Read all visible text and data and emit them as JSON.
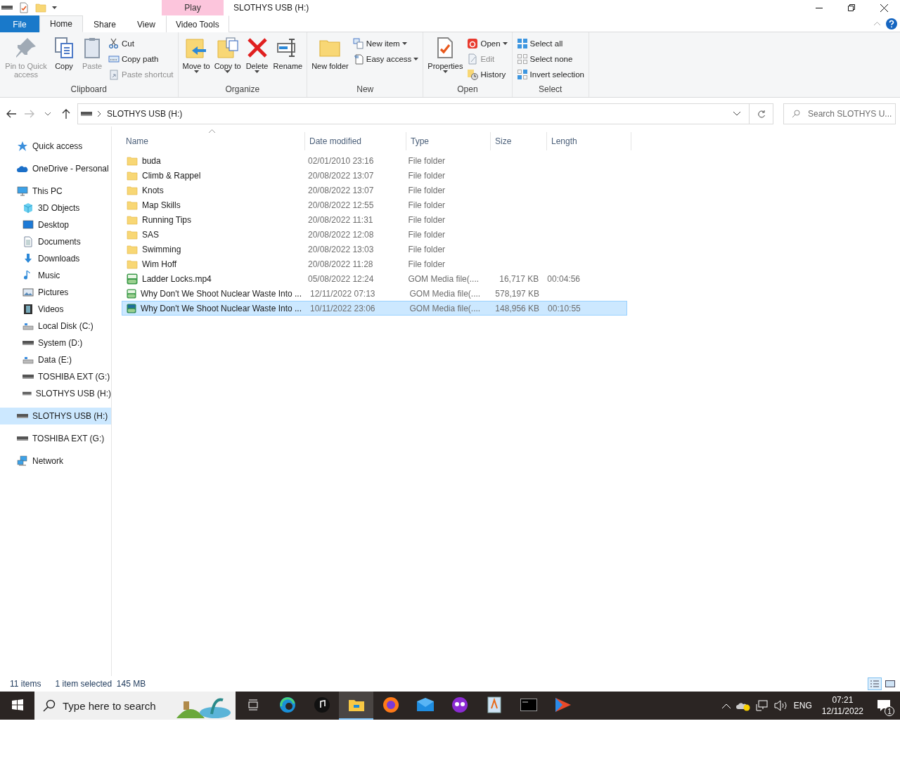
{
  "title_bar": {
    "context_tab": "Play",
    "title": "SLOTHYS USB (H:)"
  },
  "ribbon_tabs": [
    {
      "label": "File",
      "kind": "file",
      "selected": false
    },
    {
      "label": "Home",
      "kind": "normal",
      "selected": true
    },
    {
      "label": "Share",
      "kind": "normal",
      "selected": false
    },
    {
      "label": "View",
      "kind": "normal",
      "selected": false
    },
    {
      "label": "Video Tools",
      "kind": "context",
      "selected": false
    }
  ],
  "ribbon_groups": [
    {
      "label": "Clipboard",
      "items": [
        {
          "label": "Pin to Quick access",
          "kind": "large",
          "disabled": true,
          "dropdown": false
        },
        {
          "label": "Copy",
          "kind": "large",
          "disabled": false,
          "dropdown": false
        },
        {
          "label": "Paste",
          "kind": "large",
          "disabled": true,
          "dropdown": false
        },
        {
          "kind": "stack",
          "items": [
            {
              "label": "Cut",
              "disabled": false,
              "dropdown": false
            },
            {
              "label": "Copy path",
              "disabled": false,
              "dropdown": false
            },
            {
              "label": "Paste shortcut",
              "disabled": true,
              "dropdown": false
            }
          ]
        }
      ]
    },
    {
      "label": "Organize",
      "items": [
        {
          "label": "Move to",
          "kind": "large",
          "disabled": false,
          "dropdown": true
        },
        {
          "label": "Copy to",
          "kind": "large",
          "disabled": false,
          "dropdown": true
        },
        {
          "label": "Delete",
          "kind": "large",
          "disabled": false,
          "dropdown": true
        },
        {
          "label": "Rename",
          "kind": "large",
          "disabled": false,
          "dropdown": false
        }
      ]
    },
    {
      "label": "New",
      "items": [
        {
          "label": "New folder",
          "kind": "large",
          "disabled": false,
          "dropdown": false
        },
        {
          "kind": "stack",
          "items": [
            {
              "label": "New item",
              "disabled": false,
              "dropdown": true
            },
            {
              "label": "Easy access",
              "disabled": false,
              "dropdown": true
            }
          ]
        }
      ]
    },
    {
      "label": "Open",
      "items": [
        {
          "label": "Properties",
          "kind": "large",
          "disabled": false,
          "dropdown": true
        },
        {
          "kind": "stack",
          "items": [
            {
              "label": "Open",
              "disabled": false,
              "dropdown": true
            },
            {
              "label": "Edit",
              "disabled": true,
              "dropdown": false
            },
            {
              "label": "History",
              "disabled": false,
              "dropdown": false
            }
          ]
        }
      ]
    },
    {
      "label": "Select",
      "items": [
        {
          "kind": "stack",
          "items": [
            {
              "label": "Select all",
              "disabled": false,
              "dropdown": false
            },
            {
              "label": "Select none",
              "disabled": false,
              "dropdown": false
            },
            {
              "label": "Invert selection",
              "disabled": false,
              "dropdown": false
            }
          ]
        }
      ]
    }
  ],
  "address_bar": {
    "path": "SLOTHYS USB (H:)",
    "search": {
      "placeholder": "Search SLOTHYS U..."
    }
  },
  "nav_pane": [
    {
      "label": "Quick access",
      "selected": false
    },
    {
      "label": "OneDrive - Personal",
      "selected": false
    },
    {
      "label": "This PC",
      "selected": false,
      "children": [
        {
          "label": "3D Objects",
          "selected": false
        },
        {
          "label": "Desktop",
          "selected": false
        },
        {
          "label": "Documents",
          "selected": false
        },
        {
          "label": "Downloads",
          "selected": false
        },
        {
          "label": "Music",
          "selected": false
        },
        {
          "label": "Pictures",
          "selected": false
        },
        {
          "label": "Videos",
          "selected": false
        },
        {
          "label": "Local Disk (C:)",
          "selected": false
        },
        {
          "label": "System (D:)",
          "selected": false
        },
        {
          "label": "Data (E:)",
          "selected": false
        },
        {
          "label": "TOSHIBA EXT (G:)",
          "selected": false
        },
        {
          "label": "SLOTHYS USB (H:)",
          "selected": false
        }
      ]
    },
    {
      "label": "SLOTHYS USB (H:)",
      "selected": true
    },
    {
      "label": "TOSHIBA EXT (G:)",
      "selected": false
    },
    {
      "label": "Network",
      "selected": false
    }
  ],
  "file_list": {
    "columns": [
      "Name",
      "Date modified",
      "Type",
      "Size",
      "Length"
    ],
    "rows": [
      {
        "kind": "folder",
        "name": "buda",
        "date": "02/01/2010 23:16",
        "type": "File folder",
        "selected": false
      },
      {
        "kind": "folder",
        "name": "Climb & Rappel",
        "date": "20/08/2022 13:07",
        "type": "File folder",
        "selected": false
      },
      {
        "kind": "folder",
        "name": "Knots",
        "date": "20/08/2022 13:07",
        "type": "File folder",
        "selected": false
      },
      {
        "kind": "folder",
        "name": "Map Skills",
        "date": "20/08/2022 12:55",
        "type": "File folder",
        "selected": false
      },
      {
        "kind": "folder",
        "name": "Running Tips",
        "date": "20/08/2022 11:31",
        "type": "File folder",
        "selected": false
      },
      {
        "kind": "folder",
        "name": "SAS",
        "date": "20/08/2022 12:08",
        "type": "File folder",
        "selected": false
      },
      {
        "kind": "folder",
        "name": "Swimming",
        "date": "20/08/2022 13:03",
        "type": "File folder",
        "selected": false
      },
      {
        "kind": "folder",
        "name": "Wim Hoff",
        "date": "20/08/2022 11:28",
        "type": "File folder",
        "selected": false
      },
      {
        "kind": "mp4",
        "name": "Ladder Locks.mp4",
        "date": "05/08/2022 12:24",
        "type": "GOM Media file(....",
        "size": "16,717 KB",
        "length": "00:04:56",
        "selected": false
      },
      {
        "kind": "mp4",
        "name": "Why Don't We Shoot Nuclear Waste Into ...",
        "date": "12/11/2022 07:13",
        "type": "GOM Media file(....",
        "size": "578,197 KB",
        "selected": false
      },
      {
        "kind": "webm",
        "name": "Why Don't We Shoot Nuclear Waste Into ...",
        "date": "10/11/2022 23:06",
        "type": "GOM Media file(....",
        "size": "148,956 KB",
        "length": "00:10:55",
        "selected": true
      }
    ]
  },
  "status_bar": {
    "count": "11 items",
    "selection": "1 item selected  145 MB"
  },
  "taskbar": {
    "search": {
      "placeholder": "Type here to search"
    },
    "language": "ENG",
    "time": "07:21",
    "date": "12/11/2022",
    "notifications": "1"
  }
}
